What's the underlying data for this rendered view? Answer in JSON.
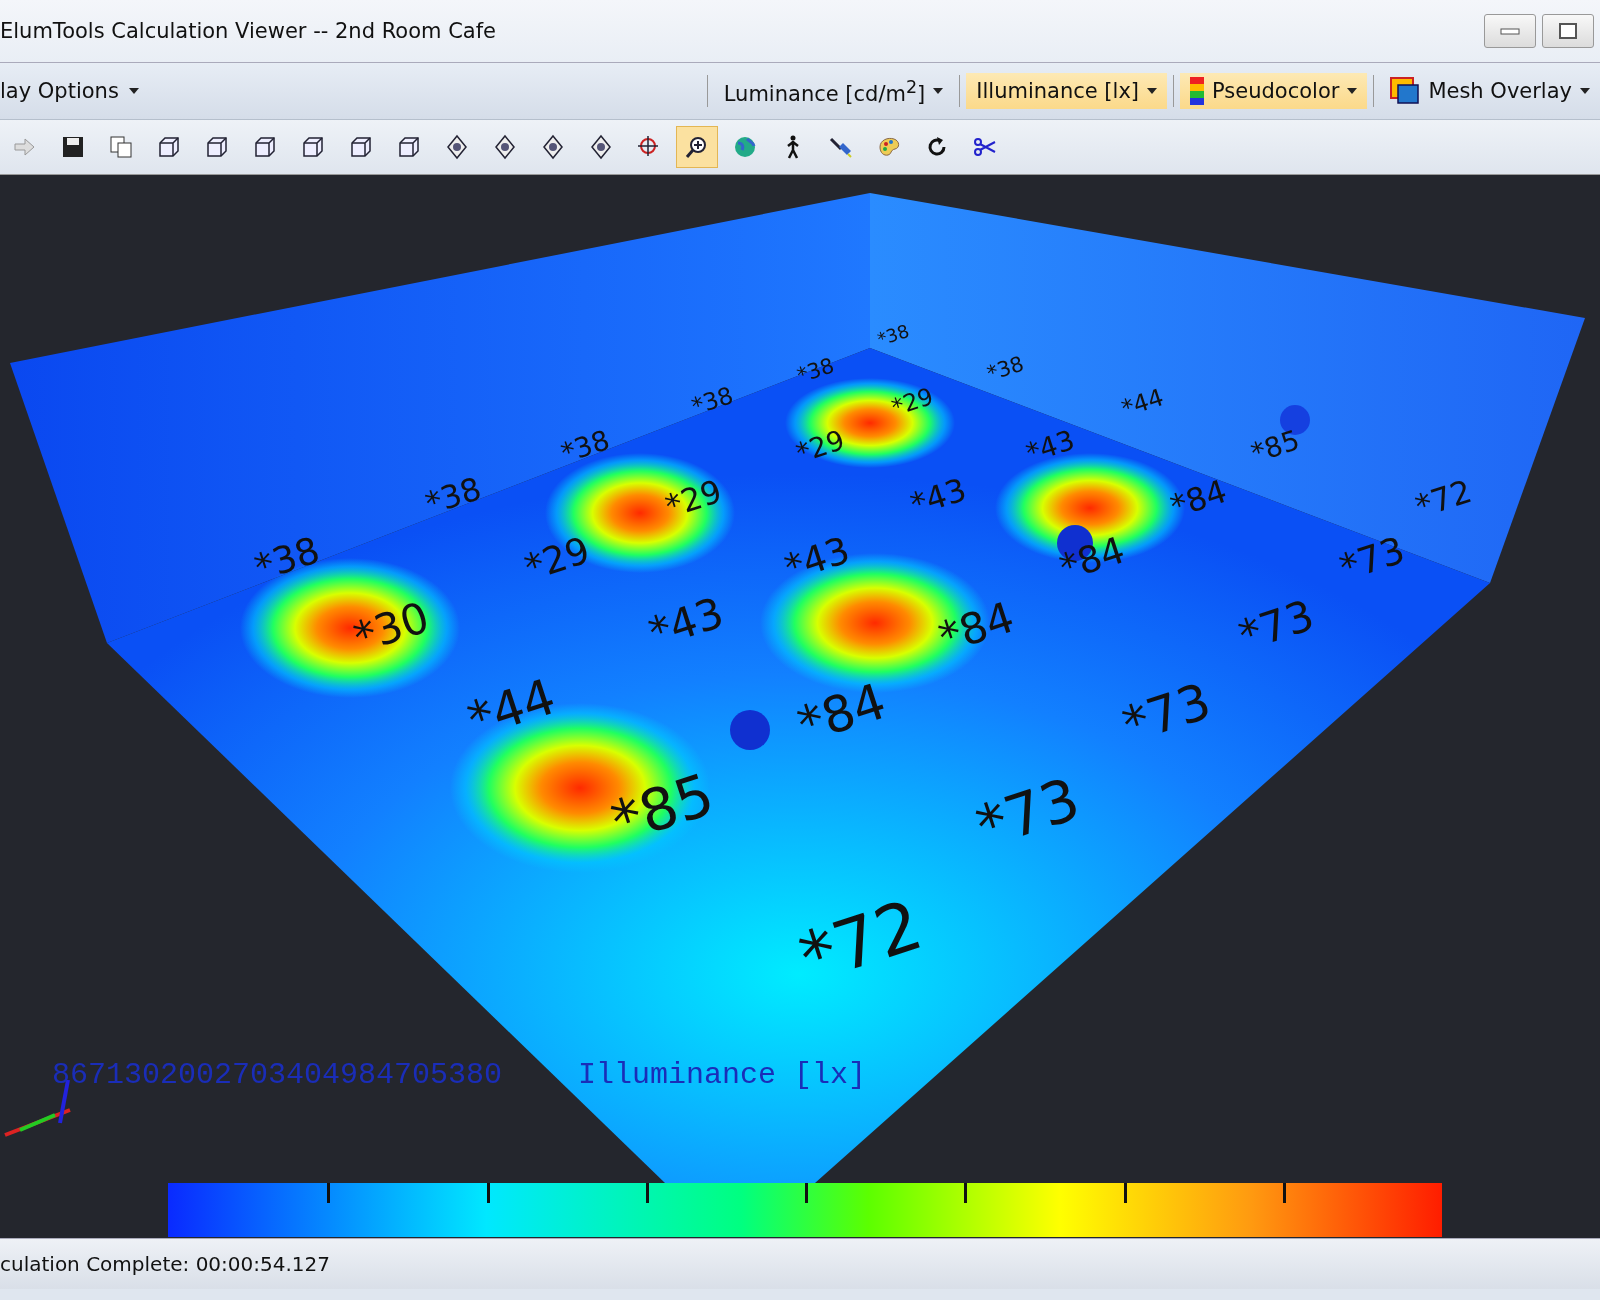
{
  "window": {
    "title": "ElumTools Calculation Viewer -- 2nd Room Cafe"
  },
  "options_toolbar": {
    "menu": "lay Options",
    "items": [
      {
        "label": "Luminance [cd/m$^{2}$]",
        "selected": false,
        "kind": "plain"
      },
      {
        "label": "Illuminance [lx]",
        "selected": true,
        "kind": "plain"
      },
      {
        "label": "Pseudocolor",
        "selected": true,
        "kind": "spectrum"
      },
      {
        "label": "Mesh Overlay",
        "selected": false,
        "kind": "mesh"
      }
    ]
  },
  "tools": [
    {
      "kind": "arrow",
      "selected": false
    },
    {
      "kind": "save",
      "selected": false
    },
    {
      "kind": "copy",
      "selected": false
    },
    {
      "kind": "cube",
      "selected": false
    },
    {
      "kind": "cube",
      "selected": false
    },
    {
      "kind": "cube",
      "selected": false
    },
    {
      "kind": "cube",
      "selected": false
    },
    {
      "kind": "cube",
      "selected": false
    },
    {
      "kind": "cube",
      "selected": false
    },
    {
      "kind": "view",
      "selected": false
    },
    {
      "kind": "view",
      "selected": false
    },
    {
      "kind": "view",
      "selected": false
    },
    {
      "kind": "view",
      "selected": false
    },
    {
      "kind": "target",
      "selected": false
    },
    {
      "kind": "zoom",
      "selected": true
    },
    {
      "kind": "globe",
      "selected": false
    },
    {
      "kind": "walk",
      "selected": false
    },
    {
      "kind": "light",
      "selected": false
    },
    {
      "kind": "palette",
      "selected": false
    },
    {
      "kind": "rotate",
      "selected": false
    },
    {
      "kind": "cut",
      "selected": false
    }
  ],
  "viewport": {
    "values": [
      {
        "text": "*38"
      },
      {
        "text": "*38"
      },
      {
        "text": "*38"
      },
      {
        "text": "*38"
      },
      {
        "text": "*29"
      },
      {
        "text": "*44"
      },
      {
        "text": "*38"
      },
      {
        "text": "*29"
      },
      {
        "text": "*43"
      },
      {
        "text": "*85"
      },
      {
        "text": "*38"
      },
      {
        "text": "*29"
      },
      {
        "text": "*43"
      },
      {
        "text": "*84"
      },
      {
        "text": "*72"
      },
      {
        "text": "*38"
      },
      {
        "text": "*29"
      },
      {
        "text": "*43"
      },
      {
        "text": "*84"
      },
      {
        "text": "*73"
      },
      {
        "text": "*30"
      },
      {
        "text": "*43"
      },
      {
        "text": "*84"
      },
      {
        "text": "*73"
      },
      {
        "text": "*44"
      },
      {
        "text": "*84"
      },
      {
        "text": "*73"
      },
      {
        "text": "*85"
      },
      {
        "text": "*73"
      },
      {
        "text": "*72"
      }
    ],
    "legend_numbers": "8671302002703404984705380",
    "legend_title": "Illuminance [lx]"
  },
  "status_bar": {
    "text": "culation Complete:  00:00:54.127"
  }
}
